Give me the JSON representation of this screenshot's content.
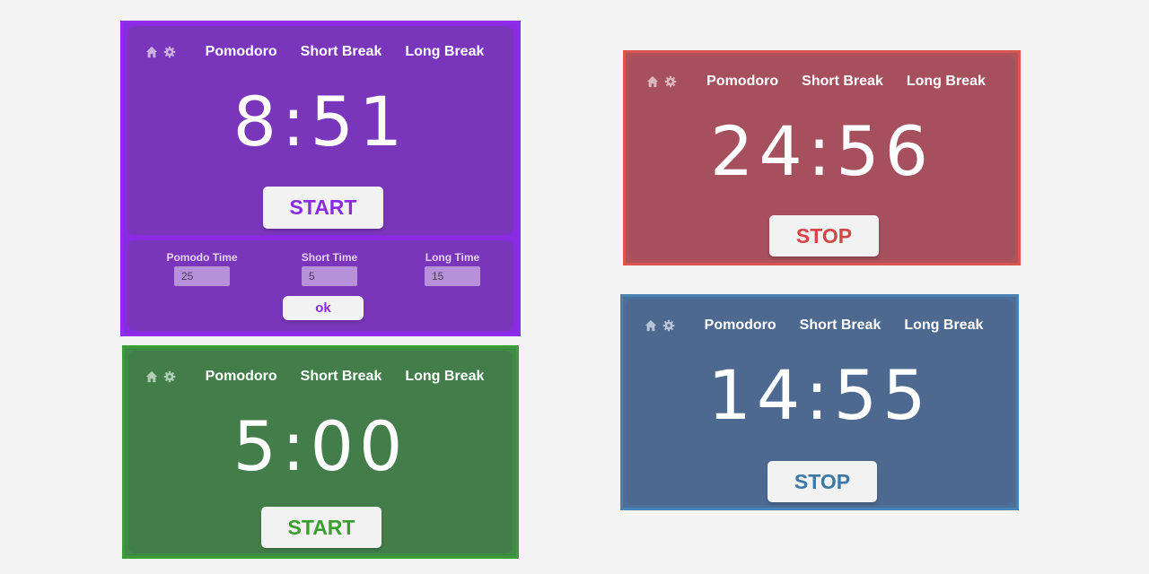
{
  "nav": {
    "pomodoro": "Pomodoro",
    "short_break": "Short Break",
    "long_break": "Long Break"
  },
  "icons": {
    "home": "home-icon",
    "settings": "gear-icon"
  },
  "cards": {
    "purple": {
      "time": "8:51",
      "button": "START",
      "color": "#7a36ba",
      "border": "#8e2cf0",
      "button_color": "#8a2be2"
    },
    "red": {
      "time": "24:56",
      "button": "STOP",
      "color": "#a5505c",
      "border": "#db5550",
      "button_color": "#d64545"
    },
    "green": {
      "time": "5:00",
      "button": "START",
      "color": "#437e4a",
      "border": "#3a9e35",
      "button_color": "#3a9e2f"
    },
    "blue": {
      "time": "14:55",
      "button": "STOP",
      "color": "#4e6990",
      "border": "#4a82b3",
      "button_color": "#3d78a8"
    }
  },
  "settings": {
    "pomodoro_label": "Pomodo Time",
    "pomodoro_value": "25",
    "short_label": "Short Time",
    "short_value": "5",
    "long_label": "Long Time",
    "long_value": "15",
    "ok": "ok"
  }
}
